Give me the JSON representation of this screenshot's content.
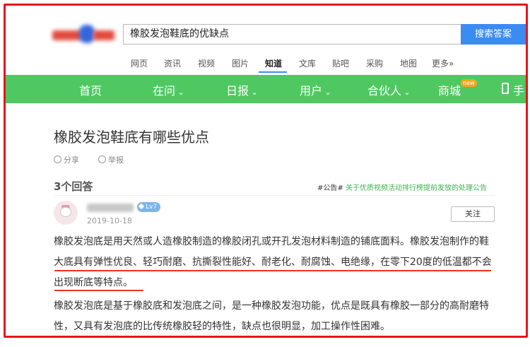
{
  "search": {
    "query": "橡胶发泡鞋底的优缺点",
    "button": "搜索答案"
  },
  "nav_links": [
    "网页",
    "资讯",
    "视频",
    "图片",
    "知道",
    "文库",
    "贴吧",
    "采购",
    "地图",
    "更多»"
  ],
  "green_nav": {
    "home": "首页",
    "ask": "在问",
    "daily": "日报",
    "user": "用户",
    "partner": "合伙人",
    "mall": "商城",
    "new_badge": "new",
    "phone": "手"
  },
  "question": {
    "title": "橡胶发泡鞋底有哪些优点",
    "share": "分享",
    "report": "举报"
  },
  "answers": {
    "count": "3个回答",
    "notice_tag": "#公告#",
    "notice_text": "关于优质视频活动排行榜提前发放的处理公告"
  },
  "answer": {
    "level": "Lv7",
    "date": "2019-10-18",
    "follow": "关注",
    "p1": "橡胶发泡底是用天然或人造橡胶制造的橡胶闭孔或开孔发泡材料制造的铺底面料。橡胶发泡制作的鞋大底具有弹性优良、轻巧耐磨、抗撕裂性能好、耐老化、耐腐蚀、电绝缘，在零下20度的低温都不会出现断底等特点。",
    "p2": "橡胶发泡底是基于橡胶底和发泡底之间，是一种橡胶发泡功能，优点是既具有橡胶一部分的高耐磨特性，又具有发泡底的比传统橡胶轻的特性，缺点也很明显，加工操作性困难。"
  },
  "colors": {
    "frame": "#e8141c",
    "green_bar": "#4fc862",
    "search_button": "#3b8cf2",
    "underline": "#e33322"
  }
}
